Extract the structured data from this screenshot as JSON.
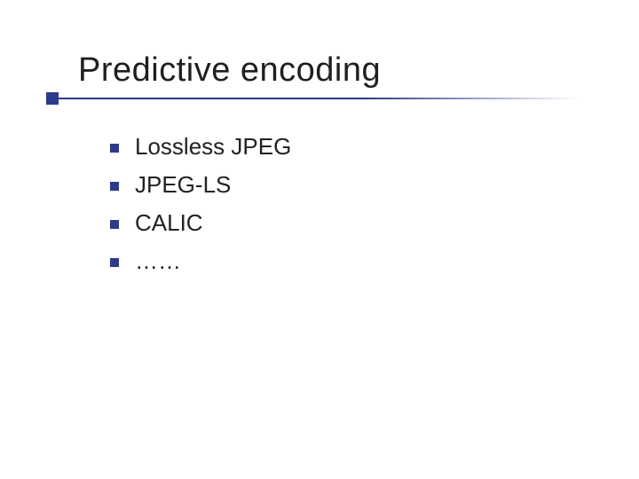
{
  "colors": {
    "accent": "#2b3a8a",
    "text": "#222222",
    "background": "#ffffff"
  },
  "slide": {
    "title": "Predictive encoding",
    "bullets": [
      {
        "text": "Lossless JPEG"
      },
      {
        "text": "JPEG-LS"
      },
      {
        "text": "CALIC"
      },
      {
        "text": "……"
      }
    ]
  }
}
